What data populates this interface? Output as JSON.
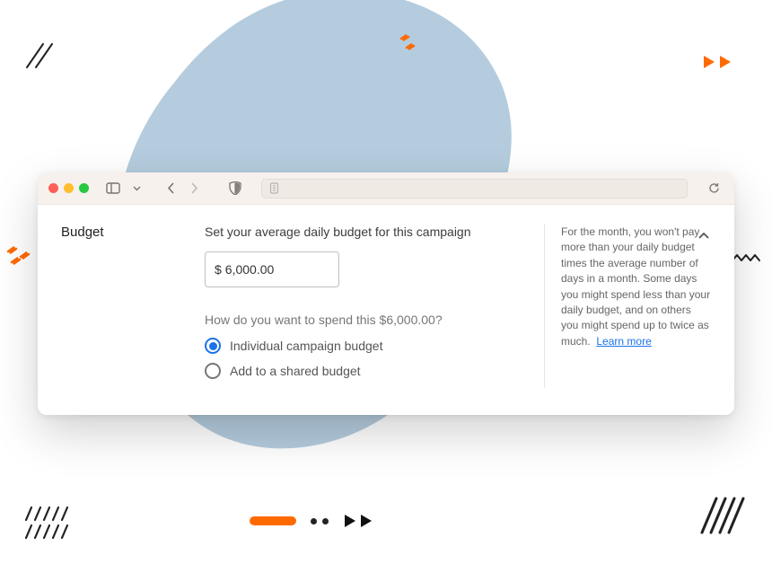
{
  "sidebar": {
    "title": "Budget"
  },
  "budget": {
    "heading": "Set your average daily budget for this campaign",
    "currency": "$",
    "amount": "6,000.00",
    "spend_question": "How do you want to spend this $6,000.00?",
    "options": {
      "individual": "Individual campaign budget",
      "shared": "Add to a shared budget"
    }
  },
  "info": {
    "text": "For the month, you won't pay more than your daily budget times the average number of days in a month. Some days you might spend less than your daily budget, and on others you might spend up to twice as much.",
    "learn_more": "Learn more"
  }
}
